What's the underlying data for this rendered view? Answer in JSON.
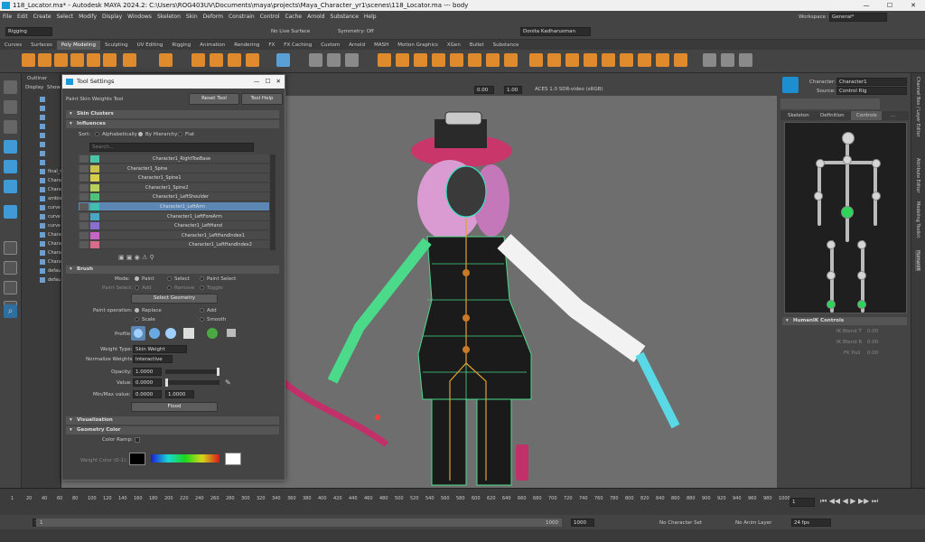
{
  "window": {
    "title": "118_Locator.ma* - Autodesk MAYA 2024.2: C:\\Users\\ROG403UV\\Documents\\maya\\projects\\Maya_Character_yr1\\scenes\\118_Locator.ma  ---  body"
  },
  "menubar": [
    "File",
    "Edit",
    "Create",
    "Select",
    "Modify",
    "Display",
    "Windows",
    "Skeleton",
    "Skin",
    "Deform",
    "Constrain",
    "Control",
    "Cache",
    "Arnold",
    "Substance",
    "Help"
  ],
  "statusline": {
    "menuset": "Rigging",
    "live_surface": "No Live Surface",
    "symmetry": "Symmetry: Off",
    "user": "Donita Kadharusman",
    "workspace_label": "Workspace :",
    "workspace": "General*"
  },
  "shelf_tabs": [
    "Curves",
    "Surfaces",
    "Poly Modeling",
    "Sculpting",
    "UV Editing",
    "Rigging",
    "Animation",
    "Rendering",
    "FX",
    "FX Caching",
    "Custom",
    "Arnold",
    "MASH",
    "Motion Graphics",
    "XGen",
    "Bullet",
    "Substance"
  ],
  "shelf_active": "Poly Modeling",
  "outliner": {
    "title": "Outliner",
    "menu": [
      "Display",
      "Show"
    ],
    "items": [
      "",
      "",
      "",
      "",
      "",
      "",
      "",
      "",
      "final_r",
      "Chara",
      "Chara",
      "ambie",
      "curve",
      "curve",
      "curve",
      "Chara",
      "Chara",
      "Chara",
      "Chara",
      "defau",
      "defau"
    ]
  },
  "viewport": {
    "value_a": "0.00",
    "value_b": "1.00",
    "colorspace": "ACES 1.0 SDR-video (sRGB)"
  },
  "tool_settings": {
    "title": "Tool Settings",
    "tool_name": "Paint Skin Weights Tool",
    "reset": "Reset Tool",
    "help": "Tool Help",
    "sections": {
      "skin_clusters": "Skin Clusters",
      "influences": "Influences",
      "brush": "Brush",
      "visualization": "Visualization",
      "geometry_color": "Geometry Color"
    },
    "sort_label": "Sort:",
    "sort_options": [
      "Alphabetically",
      "By Hierarchy",
      "Flat"
    ],
    "search_placeholder": "Search...",
    "influences": [
      {
        "name": "Character1_RightToeBase",
        "color": "#4fc3a6",
        "indent": 82,
        "selected": false
      },
      {
        "name": "Character1_Spine",
        "color": "#c9c24b",
        "indent": 54,
        "selected": false
      },
      {
        "name": "Character1_Spine1",
        "color": "#d4d04a",
        "indent": 66,
        "selected": false
      },
      {
        "name": "Character1_Spine2",
        "color": "#b7d25b",
        "indent": 74,
        "selected": false
      },
      {
        "name": "Character1_LeftShoulder",
        "color": "#4fc37a",
        "indent": 82,
        "selected": false
      },
      {
        "name": "Character1_LeftArm",
        "color": "#3fbfb0",
        "indent": 90,
        "selected": true
      },
      {
        "name": "Character1_LeftForeArm",
        "color": "#49a7c5",
        "indent": 98,
        "selected": false
      },
      {
        "name": "Character1_LeftHand",
        "color": "#8a6fd0",
        "indent": 106,
        "selected": false
      },
      {
        "name": "Character1_LeftHandIndex1",
        "color": "#c765c2",
        "indent": 114,
        "selected": false
      },
      {
        "name": "Character1_LeftHandIndex2",
        "color": "#d96c8a",
        "indent": 122,
        "selected": false
      }
    ],
    "brush": {
      "mode_label": "Mode:",
      "modes": [
        "Paint",
        "Select",
        "Paint Select"
      ],
      "paint_select_label": "Paint Select:",
      "paint_select_opts": [
        "Add",
        "Remove",
        "Toggle"
      ],
      "select_geometry": "Select Geometry",
      "paint_operation_label": "Paint operation:",
      "ops": [
        "Replace",
        "Add",
        "Scale",
        "Smooth"
      ],
      "profile_label": "Profile:",
      "weight_type_label": "Weight Type:",
      "weight_type": "Skin Weight",
      "normalize_label": "Normalize Weights:",
      "normalize": "Interactive",
      "opacity_label": "Opacity:",
      "opacity": "1.0000",
      "value_label": "Value:",
      "value": "0.0000",
      "minmax_label": "Min/Max value:",
      "min": "0.0000",
      "max": "1.0000",
      "flood": "Flood"
    },
    "color_ramp_label": "Color Ramp:",
    "weight_color_label": "Weight Color (0-1):"
  },
  "hik": {
    "character_label": "Character:",
    "character": "Character1",
    "source_label": "Source:",
    "source": "Control Rig",
    "tabs": [
      "Skeleton",
      "Definition",
      "Controls",
      "..."
    ],
    "active_tab": "Controls",
    "controls_title": "HumanIK Controls",
    "ik_blend_t": "IK Blend T",
    "ik_blend_r": "IK Blend R",
    "fk_pull": "FK Pull",
    "zero": "0.00"
  },
  "side_tabs": [
    "Channel Box / Layer Editor",
    "Attribute Editor",
    "Modeling Toolkit",
    "HumanIK"
  ],
  "timeline": {
    "ticks": [
      "1",
      "20",
      "40",
      "60",
      "80",
      "100",
      "120",
      "140",
      "160",
      "180",
      "200",
      "220",
      "240",
      "260",
      "280",
      "300",
      "320",
      "340",
      "360",
      "380",
      "400",
      "420",
      "440",
      "460",
      "480",
      "500",
      "520",
      "540",
      "560",
      "580",
      "600",
      "620",
      "640",
      "660",
      "680",
      "700",
      "720",
      "740",
      "760",
      "780",
      "800",
      "820",
      "840",
      "860",
      "880",
      "900",
      "920",
      "940",
      "960",
      "980",
      "1000"
    ],
    "current": "1"
  },
  "range": {
    "start": "1",
    "inner_start": "1",
    "inner_end": "1000",
    "end": "1000",
    "character_set": "No Character Set",
    "anim_layer": "No Anim Layer",
    "fps": "24 fps"
  },
  "colors": {
    "accent": "#5c87b5",
    "panel": "#444444",
    "viewport": "#6e6e6e"
  }
}
